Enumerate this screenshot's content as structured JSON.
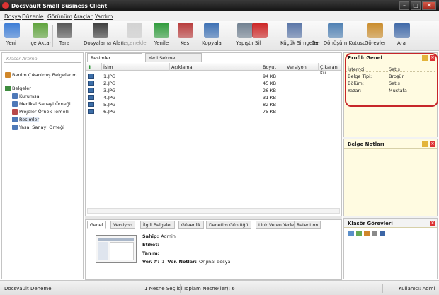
{
  "window": {
    "title": "Docsvault Small Business Client"
  },
  "menu": [
    "Dosya",
    "Düzenle",
    "Görünüm",
    "Araçlar",
    "Yardım"
  ],
  "toolbar": {
    "buttons": [
      {
        "label": "Yeni",
        "icon": "new-doc-icon",
        "color": "#3a7bd5"
      },
      {
        "label": "İçe Aktar",
        "icon": "import-icon",
        "color": "#5da13a"
      },
      {
        "label": "Tara",
        "icon": "scanner-icon",
        "color": "#555555"
      },
      {
        "label": "Dosyalama Alanı",
        "icon": "filing-cabinet-icon",
        "color": "#3c3c3c"
      },
      {
        "label": "Seçenekler",
        "icon": "options-icon",
        "color": "#8a8a8a",
        "disabled": true
      },
      {
        "label": "Yenile",
        "icon": "refresh-icon",
        "color": "#2e9a3a"
      },
      {
        "label": "Kes",
        "icon": "scissors-icon",
        "color": "#b73a3a"
      },
      {
        "label": "Kopyala",
        "icon": "copy-icon",
        "color": "#3b6fb3"
      },
      {
        "label": "Yapıştır",
        "icon": "paste-icon",
        "color": "#6f7f8f"
      },
      {
        "label": "Sil",
        "icon": "delete-icon",
        "color": "#cc2222"
      },
      {
        "label": "Küçük Simgeler",
        "icon": "small-icons-icon",
        "color": "#5874a6"
      },
      {
        "label": "Geri Dönüşüm Kutusu",
        "icon": "recycle-bin-icon",
        "color": "#4d7fb2"
      },
      {
        "label": "Görevler",
        "icon": "tasks-icon",
        "color": "#c98b2a"
      },
      {
        "label": "Ara",
        "icon": "search-binoculars-icon",
        "color": "#3c66a6"
      }
    ]
  },
  "sidebar": {
    "search_placeholder": "Klasör Arama",
    "items": [
      {
        "label": "Benim Çıkarılmış Belgelerim",
        "icon": "checked-out-icon",
        "color": "#d0872a"
      },
      {
        "label": "Belgeler",
        "icon": "documents-icon",
        "color": "#3e8c3e"
      },
      {
        "label": "Kurumsal",
        "icon": "folder-icon",
        "color": "#4e79b8"
      },
      {
        "label": "Medikal Sanayi Örneği",
        "icon": "folder-icon",
        "color": "#4e79b8"
      },
      {
        "label": "Projeler Örnek Temelli",
        "icon": "folder-icon",
        "color": "#b8494a"
      },
      {
        "label": "Resimler",
        "icon": "folder-icon",
        "color": "#4e79b8"
      },
      {
        "label": "Yasal Sanayi Örneği",
        "icon": "folder-icon",
        "color": "#4e79b8"
      }
    ]
  },
  "tabs": [
    "Resimler",
    "Yeni Sekme"
  ],
  "grid": {
    "columns": [
      "İsim",
      "Açıklama",
      "Boyut",
      "Versiyon",
      "Çıkaran Ku"
    ],
    "rows": [
      {
        "name": "1.JPG",
        "size": "94 KB"
      },
      {
        "name": "2.JPG",
        "size": "45 KB"
      },
      {
        "name": "3.JPG",
        "size": "26 KB"
      },
      {
        "name": "4.JPG",
        "size": "31 KB"
      },
      {
        "name": "5.JPG",
        "size": "82 KB"
      },
      {
        "name": "6.JPG",
        "size": "75 KB"
      }
    ]
  },
  "details": {
    "tabs": [
      "Genel",
      "Versiyon",
      "İlgili Belgeler",
      "Güvenlik",
      "Denetim Günlüğü",
      "Link Veren Yerler",
      "Retention"
    ],
    "props": [
      {
        "k": "Sahip:",
        "v": "Admin"
      },
      {
        "k": "Etiket:",
        "v": ""
      },
      {
        "k": "Tanım:",
        "v": ""
      }
    ],
    "ver_label": "Ver. #:",
    "ver_value": "1",
    "ver_notes_label": "Ver. Notlar:",
    "ver_notes_value": "Orijinal dosya"
  },
  "profile": {
    "title": "Profil: Genel",
    "fields": [
      {
        "k": "İstemci:",
        "v": "Satış"
      },
      {
        "k": "Belge Tipi:",
        "v": "Broşür"
      },
      {
        "k": "Bölüm:",
        "v": "Satış"
      },
      {
        "k": "Yazar:",
        "v": "Mustafa"
      }
    ]
  },
  "notes_title": "Belge Notları",
  "tasks_title": "Klasör Görevleri",
  "status": {
    "app": "Docsvault Deneme",
    "sel": "1 Nesne  Seçildi",
    "total": "Toplam Nesne(ler): 6",
    "user": "Kullanıcı: Admi"
  },
  "colors": {
    "highlight": "#c7262a",
    "panel_bg": "#fffbe1"
  }
}
